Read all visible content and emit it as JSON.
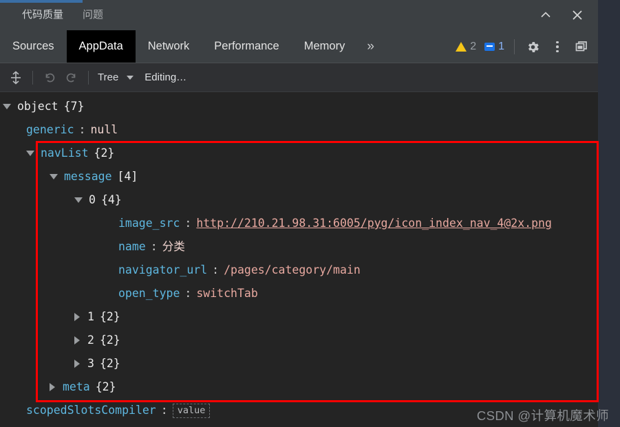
{
  "window": {
    "collapse_icon": "chevron-up-icon",
    "close_icon": "close-icon"
  },
  "drawer_tabs": [
    {
      "label": "代码质量",
      "active": true
    },
    {
      "label": "问题",
      "active": false
    }
  ],
  "tabs": [
    {
      "label": "Sources",
      "active": false
    },
    {
      "label": "AppData",
      "active": true
    },
    {
      "label": "Network",
      "active": false
    },
    {
      "label": "Performance",
      "active": false
    },
    {
      "label": "Memory",
      "active": false
    }
  ],
  "tab_overflow_label": "»",
  "status": {
    "warning_icon": "warning-triangle-icon",
    "warning_count": "2",
    "message_icon": "message-icon",
    "message_count": "1",
    "settings_icon": "gear-icon",
    "more_icon": "kebab-menu-icon",
    "dock_icon": "dock-window-icon"
  },
  "subtoolbar": {
    "expand_icon": "expand-collapse-icon",
    "undo_icon": "undo-icon",
    "redo_icon": "redo-icon",
    "view_label": "Tree",
    "view_caret_icon": "chevron-down-icon",
    "editing_label": "Editing…"
  },
  "tree": {
    "root": {
      "key": "object",
      "count": "{7}"
    },
    "generic": {
      "key": "generic",
      "colon": ":",
      "value": "null"
    },
    "navList": {
      "key": "navList",
      "count": "{2}"
    },
    "message": {
      "key": "message",
      "count": "[4]"
    },
    "item0": {
      "key": "0",
      "count": "{4}"
    },
    "fields": [
      {
        "key": "image_src",
        "colon": ":",
        "value": "http://210.21.98.31:6005/pyg/icon_index_nav_4@2x.png"
      },
      {
        "key": "name",
        "colon": ":",
        "value": "分类"
      },
      {
        "key": "navigator_url",
        "colon": ":",
        "value": "/pages/category/main"
      },
      {
        "key": "open_type",
        "colon": ":",
        "value": "switchTab"
      }
    ],
    "collapsed_items": [
      {
        "key": "1",
        "count": "{2}"
      },
      {
        "key": "2",
        "count": "{2}"
      },
      {
        "key": "3",
        "count": "{2}"
      }
    ],
    "meta": {
      "key": "meta",
      "count": "{2}"
    },
    "scopedSlotsCompiler": {
      "key": "scopedSlotsCompiler",
      "colon": ":",
      "value": "value"
    }
  },
  "annotation": {
    "color": "#ff0000"
  },
  "watermark": "CSDN @计算机魔术师"
}
